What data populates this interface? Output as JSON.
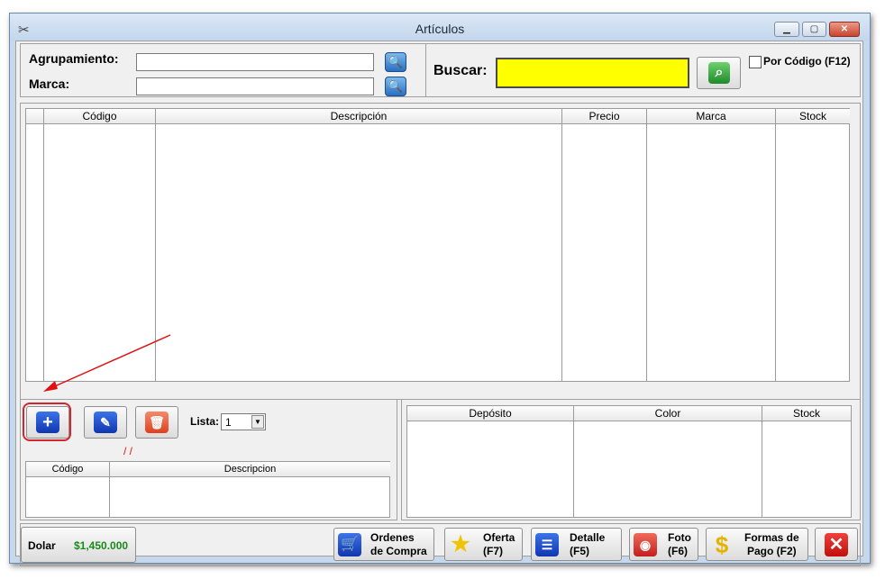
{
  "window": {
    "title": "Artículos",
    "min": "▁",
    "max": "▢",
    "close": "✕",
    "app_icon": "scissors-icon"
  },
  "filters": {
    "agrupamiento_label": "Agrupamiento:",
    "agrupamiento_value": "",
    "marca_label": "Marca:",
    "marca_value": ""
  },
  "search": {
    "label": "Buscar:",
    "value": "",
    "por_codigo_label": "Por Código (F12)",
    "por_codigo_checked": false,
    "highlight_color": "#ffff00"
  },
  "articles_table": {
    "columns": [
      "",
      "Código",
      "Descripción",
      "Precio",
      "Marca",
      "Stock"
    ],
    "rows": []
  },
  "toolbar": {
    "lista_label": "Lista:",
    "lista_value": "1",
    "date_text": "/ /"
  },
  "sub_table": {
    "columns": [
      "Código",
      "Descripcion"
    ],
    "rows": []
  },
  "stock_table": {
    "columns": [
      "Depósito",
      "Color",
      "Stock"
    ],
    "rows": []
  },
  "footer": {
    "dolar_label": "Dolar",
    "dolar_value": "$1,450.000",
    "buttons": [
      {
        "line1": "Ordenes",
        "line2": "de Compra",
        "icon": "cart-icon"
      },
      {
        "line1": "Oferta",
        "line2": "(F7)",
        "icon": "star-icon"
      },
      {
        "line1": "Detalle",
        "line2": "(F5)",
        "icon": "detail-icon"
      },
      {
        "line1": "Foto",
        "line2": "(F6)",
        "icon": "camera-icon"
      },
      {
        "line1": "Formas de",
        "line2": "Pago (F2)",
        "icon": "dollar-icon"
      }
    ],
    "close_icon": "close-icon"
  }
}
